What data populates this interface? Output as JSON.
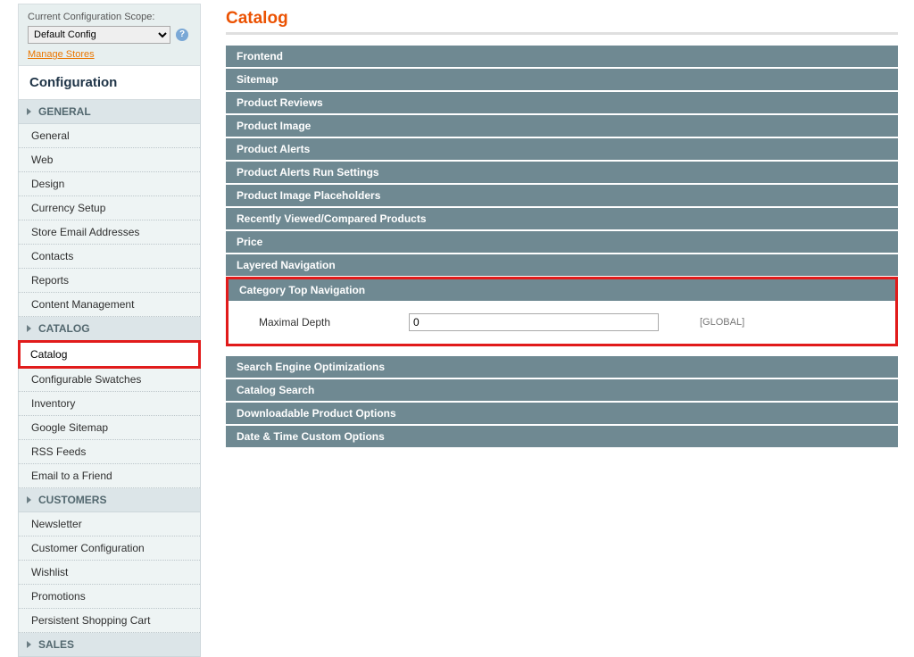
{
  "scope": {
    "label": "Current Configuration Scope:",
    "selected": "Default Config",
    "manage_link": "Manage Stores"
  },
  "configuration_title": "Configuration",
  "sidebar": {
    "groups": [
      {
        "title": "GENERAL",
        "items": [
          "General",
          "Web",
          "Design",
          "Currency Setup",
          "Store Email Addresses",
          "Contacts",
          "Reports",
          "Content Management"
        ],
        "selected": null
      },
      {
        "title": "CATALOG",
        "items": [
          "Catalog",
          "Configurable Swatches",
          "Inventory",
          "Google Sitemap",
          "RSS Feeds",
          "Email to a Friend"
        ],
        "selected": "Catalog"
      },
      {
        "title": "CUSTOMERS",
        "items": [
          "Newsletter",
          "Customer Configuration",
          "Wishlist",
          "Promotions",
          "Persistent Shopping Cart"
        ],
        "selected": null
      },
      {
        "title": "SALES",
        "items": [],
        "selected": null
      }
    ]
  },
  "page": {
    "title": "Catalog",
    "sections_before": [
      "Frontend",
      "Sitemap",
      "Product Reviews",
      "Product Image",
      "Product Alerts",
      "Product Alerts Run Settings",
      "Product Image Placeholders",
      "Recently Viewed/Compared Products",
      "Price",
      "Layered Navigation"
    ],
    "highlighted_section": {
      "title": "Category Top Navigation",
      "field_label": "Maximal Depth",
      "field_value": "0",
      "field_scope": "[GLOBAL]"
    },
    "sections_after": [
      "Search Engine Optimizations",
      "Catalog Search",
      "Downloadable Product Options",
      "Date & Time Custom Options"
    ]
  }
}
